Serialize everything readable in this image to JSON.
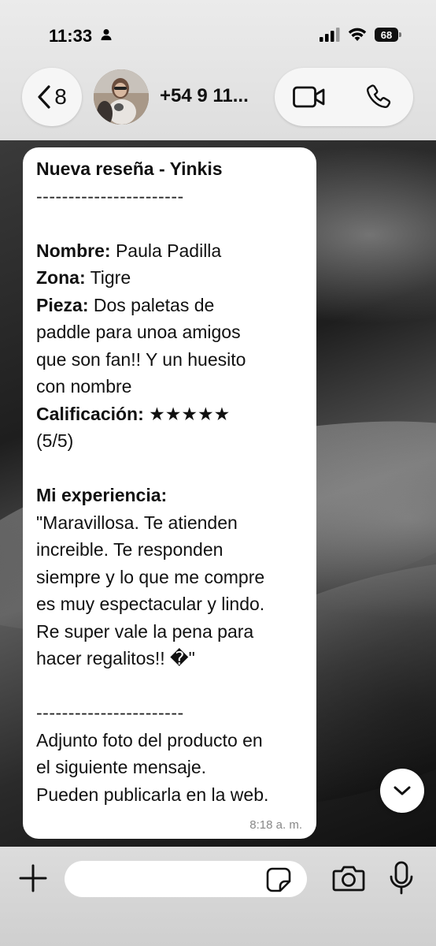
{
  "status": {
    "time": "11:33",
    "battery": "68"
  },
  "header": {
    "back_count": "8",
    "contact_name": "+54 9 11..."
  },
  "message": {
    "title": "Nueva reseña - Yinkis",
    "separator": "-----------------------",
    "name_label": "Nombre:",
    "name_value": " Paula Padilla",
    "zone_label": "Zona:",
    "zone_value": " Tigre",
    "piece_label": "Pieza:",
    "piece_lines": [
      " Dos paletas de",
      "paddle para unoa amigos",
      "que son fan!! Y un huesito",
      "con nombre"
    ],
    "rating_label": "Calificación:",
    "rating_stars": " ★★★★★",
    "rating_value": "(5/5)",
    "experience_label": "Mi experiencia:",
    "experience_lines": [
      "\"Maravillosa. Te atienden",
      "increible. Te responden",
      "siempre y lo que me compre",
      "es muy espectacular y lindo.",
      "Re super vale la pena para",
      "hacer regalitos!! �\""
    ],
    "separator_bottom": "-----------------------",
    "closing_lines": [
      "Adjunto foto del producto en",
      "el siguiente mensaje.",
      "Pueden publicarla en la web."
    ],
    "timestamp": "8:18 a. m."
  },
  "composer": {
    "input_value": "",
    "input_placeholder": ""
  },
  "icons": {
    "person": "person-icon",
    "signal": "cellular-signal-icon",
    "wifi": "wifi-icon",
    "back": "chevron-left-icon",
    "video": "video-camera-icon",
    "phone": "phone-icon",
    "scroll": "chevron-down-icon",
    "plus": "plus-icon",
    "sticker": "sticker-icon",
    "camera": "camera-icon",
    "mic": "microphone-icon"
  }
}
